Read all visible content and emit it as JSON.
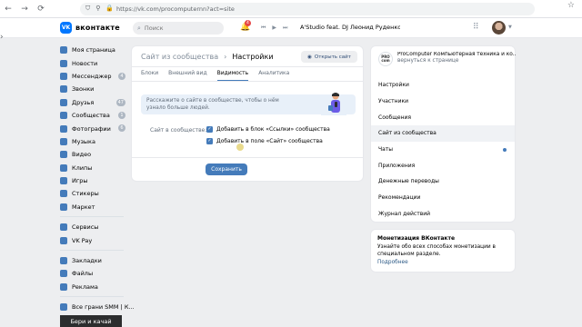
{
  "browser": {
    "url": "https://vk.com/procomputernn?act=site",
    "back_label": "←",
    "forward_label": "→",
    "reload_label": "⟳"
  },
  "header": {
    "logo_text": "вконтакте",
    "search_placeholder": "Поиск",
    "notification_count": "4",
    "track_title": "A'Studio feat. DJ Леонид Руденко — Ут..."
  },
  "left_menu": {
    "items": [
      {
        "label": "Моя страница",
        "count": ""
      },
      {
        "label": "Новости",
        "count": ""
      },
      {
        "label": "Мессенджер",
        "count": "4"
      },
      {
        "label": "Звонки",
        "count": ""
      },
      {
        "label": "Друзья",
        "count": "47"
      },
      {
        "label": "Сообщества",
        "count": "1"
      },
      {
        "label": "Фотографии",
        "count": "6"
      },
      {
        "label": "Музыка",
        "count": ""
      },
      {
        "label": "Видео",
        "count": ""
      },
      {
        "label": "Клипы",
        "count": ""
      },
      {
        "label": "Игры",
        "count": ""
      },
      {
        "label": "Стикеры",
        "count": ""
      },
      {
        "label": "Маркет",
        "count": ""
      }
    ],
    "items2": [
      {
        "label": "Сервисы"
      },
      {
        "label": "VK Pay"
      }
    ],
    "items3": [
      {
        "label": "Закладки"
      },
      {
        "label": "Файлы"
      },
      {
        "label": "Реклама"
      }
    ],
    "items4": [
      {
        "label": "Все грани SMM | К..."
      }
    ],
    "promo": "Бери и качай"
  },
  "main": {
    "breadcrumb_parent": "Сайт из сообщества",
    "breadcrumb_sep": "›",
    "breadcrumb_current": "Настройки",
    "open_site": "Открыть сайт",
    "tabs": [
      "Блоки",
      "Внешний вид",
      "Видимость",
      "Аналитика"
    ],
    "active_tab": "Видимость",
    "info_text": "Расскажите о сайте в сообществе, чтобы о нём узнало больше людей.",
    "setting_label": "Сайт в сообществе:",
    "checks": [
      {
        "label": "Добавить в блок «Ссылки» сообщества",
        "checked": true
      },
      {
        "label": "Добавить в поле «Сайт» сообщества",
        "checked": true
      }
    ],
    "save": "Сохранить"
  },
  "right": {
    "group_logo_line1": "PRO",
    "group_logo_line2": "com",
    "group_name": "ProComputer Компьютерная техника и ко...",
    "back_link": "вернуться к странице",
    "nav": [
      {
        "label": "Настройки",
        "active": false,
        "dot": false
      },
      {
        "label": "Участники",
        "active": false,
        "dot": false
      },
      {
        "label": "Сообщения",
        "active": false,
        "dot": false
      },
      {
        "label": "Сайт из сообщества",
        "active": true,
        "dot": false
      },
      {
        "label": "Чаты",
        "active": false,
        "dot": true
      },
      {
        "label": "Приложения",
        "active": false,
        "dot": false
      },
      {
        "label": "Денежные переводы",
        "active": false,
        "dot": false
      },
      {
        "label": "Рекомендации",
        "active": false,
        "dot": false
      },
      {
        "label": "Журнал действий",
        "active": false,
        "dot": false
      }
    ],
    "monet_title": "Монетизация ВКонтакте",
    "monet_text": "Узнайте обо всех способах монетизации в специальном разделе.",
    "monet_link": "Подробнее"
  },
  "colors": {
    "accent": "#447bba",
    "brand": "#0077ff",
    "page_bg": "#edeef0"
  }
}
